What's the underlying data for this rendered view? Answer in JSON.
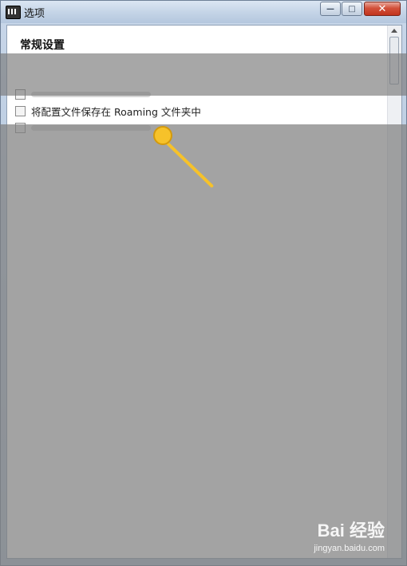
{
  "window": {
    "title": "选项",
    "controls": {
      "minimize": "—",
      "maximize": "□",
      "close": "✕"
    }
  },
  "content": {
    "section_title": "常规设置",
    "option_roaming": "将配置文件保存在 Roaming 文件夹中"
  },
  "watermark": {
    "brand": "Bai 经验",
    "url": "jingyan.baidu.com"
  },
  "colors": {
    "pointer": "#f6c22a",
    "overlay": "#808080"
  }
}
